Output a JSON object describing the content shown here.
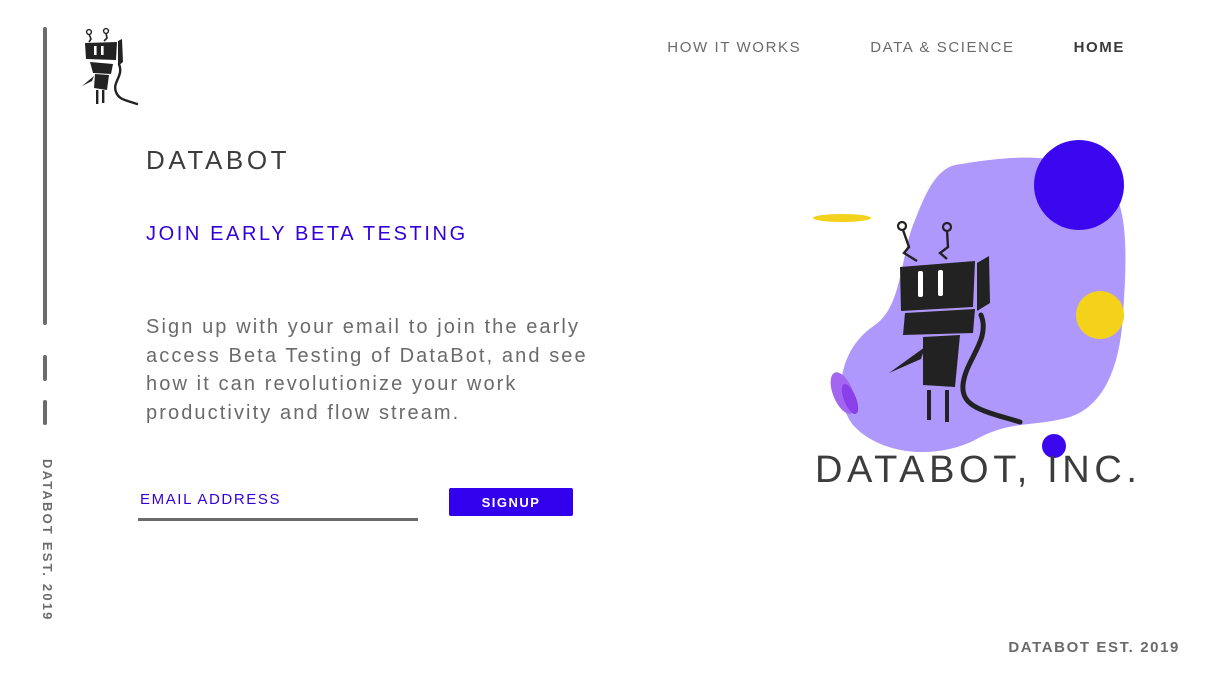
{
  "nav": {
    "how_it_works": "HOW IT WORKS",
    "data_science": "DATA & SCIENCE",
    "home": "HOME"
  },
  "sidebar": {
    "vertical_text": "DATABOT EST. 2019"
  },
  "hero": {
    "brand": "DATABOT",
    "subheading": "JOIN EARLY BETA TESTING",
    "description": "Sign up with your email to join the early access Beta Testing of DataBot, and see how it can revolutionize your work productivity and flow stream."
  },
  "form": {
    "email_placeholder": "EMAIL ADDRESS",
    "email_value": "",
    "signup_label": "SIGNUP"
  },
  "illustration": {
    "company_name": "DATABOT, INC."
  },
  "footer": {
    "text": "DATABOT EST. 2019"
  },
  "colors": {
    "accent": "#3300ee",
    "blob": "#ae98fb",
    "yellow": "#f5d21a",
    "text_dark": "#3c3c3c",
    "text_gray": "#6a6a6a"
  },
  "icons": {
    "logo": "robot-logo-icon",
    "illustration": "robot-illustration"
  }
}
